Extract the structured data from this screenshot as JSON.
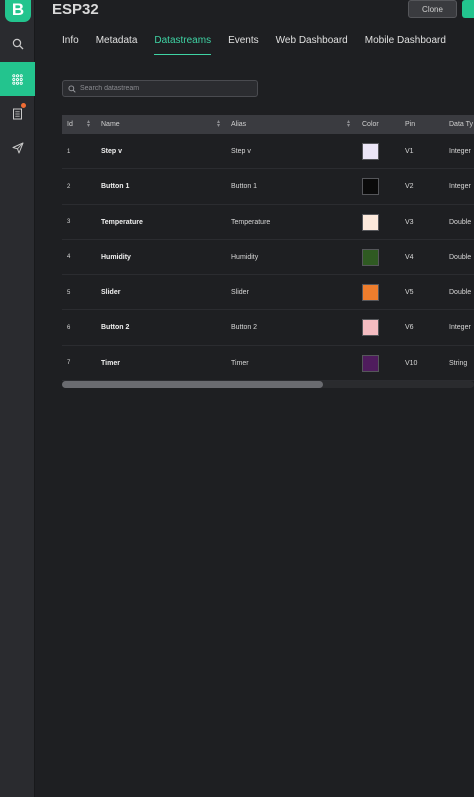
{
  "sidebar": {
    "logo": "B",
    "items": [
      {
        "name": "search-icon"
      },
      {
        "name": "grid-icon",
        "active": true
      },
      {
        "name": "document-icon",
        "notification": true
      },
      {
        "name": "send-icon"
      }
    ]
  },
  "header": {
    "title": "ESP32",
    "clone_label": "Clone"
  },
  "tabs": [
    "Info",
    "Metadata",
    "Datastreams",
    "Events",
    "Web Dashboard",
    "Mobile Dashboard"
  ],
  "active_tab": "Datastreams",
  "search": {
    "placeholder": "Search datastream",
    "value": ""
  },
  "table": {
    "columns": [
      "Id",
      "Name",
      "Alias",
      "Color",
      "Pin",
      "Data Ty"
    ],
    "rows": [
      {
        "id": "1",
        "name": "Step v",
        "alias": "Step v",
        "color": "#ece6f7",
        "pin": "V1",
        "type": "Integer"
      },
      {
        "id": "2",
        "name": "Button 1",
        "alias": "Button 1",
        "color": "#0a0a0a",
        "pin": "V2",
        "type": "Integer"
      },
      {
        "id": "3",
        "name": "Temperature",
        "alias": "Temperature",
        "color": "#fde9dc",
        "pin": "V3",
        "type": "Double"
      },
      {
        "id": "4",
        "name": "Humidity",
        "alias": "Humidity",
        "color": "#2f5a22",
        "pin": "V4",
        "type": "Double"
      },
      {
        "id": "5",
        "name": "Slider",
        "alias": "Slider",
        "color": "#ee7d2d",
        "pin": "V5",
        "type": "Double"
      },
      {
        "id": "6",
        "name": "Button 2",
        "alias": "Button 2",
        "color": "#f4bcc1",
        "pin": "V6",
        "type": "Integer"
      },
      {
        "id": "7",
        "name": "Timer",
        "alias": "Timer",
        "color": "#4f1c5d",
        "pin": "V10",
        "type": "String"
      }
    ]
  },
  "colors": {
    "accent": "#23c48e",
    "background": "#1e1f22",
    "sidebar": "#2a2b2f"
  }
}
